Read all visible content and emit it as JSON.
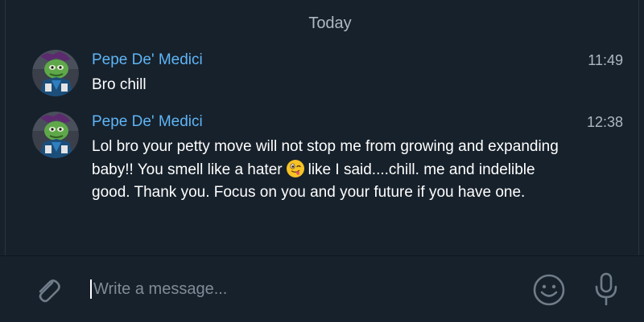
{
  "chat": {
    "date_separator": "Today",
    "messages": [
      {
        "sender": "Pepe De' Medici",
        "time": "11:49",
        "text": "Bro chill",
        "avatar_icon": "pepe-avatar"
      },
      {
        "sender": "Pepe De' Medici",
        "time": "12:38",
        "text_before_emoji": "Lol bro your petty move will not stop me from growing and expanding baby!! You smell like a hater",
        "emoji": "winking-face-with-tongue",
        "text_after_emoji": "like I said....chill. me and indelible good. Thank you. Focus on you and your future if you have one.",
        "avatar_icon": "pepe-avatar"
      }
    ]
  },
  "composer": {
    "placeholder": "Write a message...",
    "value": "",
    "attach_icon": "paperclip-icon",
    "emoji_icon": "smile-icon",
    "voice_icon": "microphone-icon"
  },
  "colors": {
    "background": "#17212b",
    "sender_name": "#5eb5f7",
    "message_text": "#ffffff",
    "muted_text": "#aeb7c2",
    "placeholder": "#7f8b97"
  }
}
